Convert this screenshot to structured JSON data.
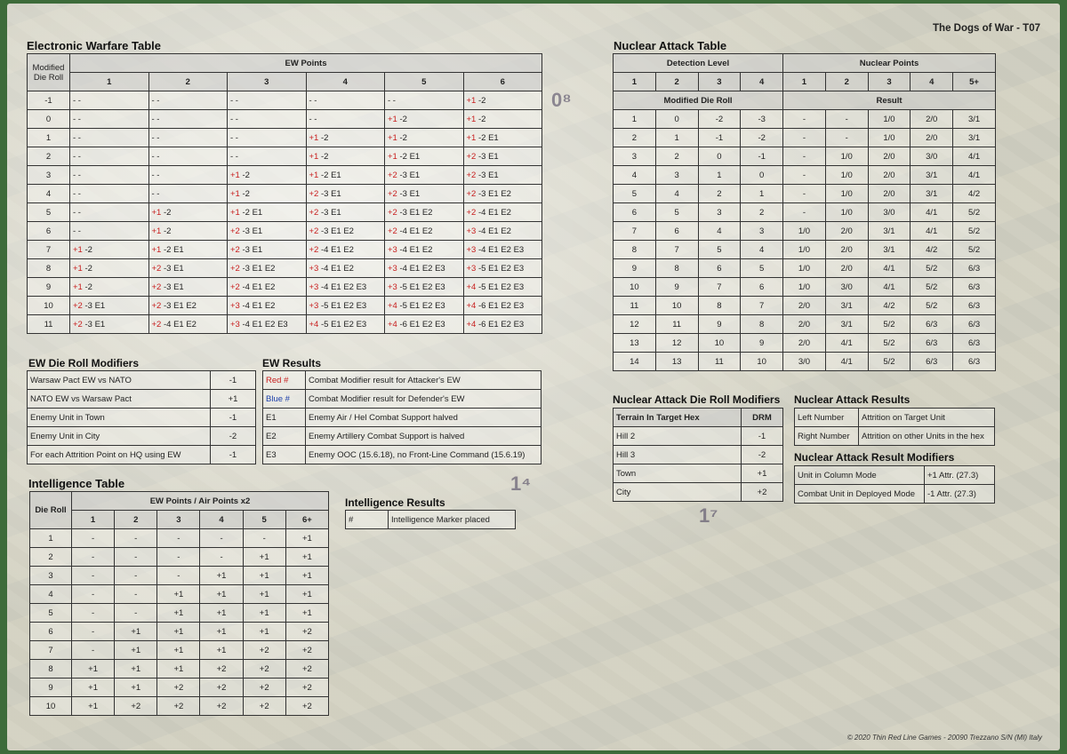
{
  "sheet_title": "The Dogs of War - T07",
  "copyright": "© 2020 Thin Red Line Games - 20090 Trezzano S/N (MI) Italy",
  "map_labels": [
    "0⁸",
    "1⁴",
    "1⁷"
  ],
  "ew_table": {
    "title": "Electronic Warfare Table",
    "corner": "Modified Die Roll",
    "group_header": "EW Points",
    "cols": [
      "1",
      "2",
      "3",
      "4",
      "5",
      "6"
    ],
    "rows": [
      {
        "roll": "-1",
        "cells": [
          [
            "",
            "- -"
          ],
          [
            "",
            "- -"
          ],
          [
            "",
            "- -"
          ],
          [
            "",
            "- -"
          ],
          [
            "",
            "- -"
          ],
          [
            "+1",
            "-2"
          ]
        ]
      },
      {
        "roll": "0",
        "cells": [
          [
            "",
            "- -"
          ],
          [
            "",
            "- -"
          ],
          [
            "",
            "- -"
          ],
          [
            "",
            "- -"
          ],
          [
            "+1",
            "-2"
          ],
          [
            "+1",
            "-2"
          ]
        ]
      },
      {
        "roll": "1",
        "cells": [
          [
            "",
            "- -"
          ],
          [
            "",
            "- -"
          ],
          [
            "",
            "- -"
          ],
          [
            "+1",
            "-2"
          ],
          [
            "+1",
            "-2"
          ],
          [
            "+1",
            "-2  E1"
          ]
        ]
      },
      {
        "roll": "2",
        "cells": [
          [
            "",
            "- -"
          ],
          [
            "",
            "- -"
          ],
          [
            "",
            "- -"
          ],
          [
            "+1",
            "-2"
          ],
          [
            "+1",
            "-2  E1"
          ],
          [
            "+2",
            "-3  E1"
          ]
        ]
      },
      {
        "roll": "3",
        "cells": [
          [
            "",
            "- -"
          ],
          [
            "",
            "- -"
          ],
          [
            "+1",
            "-2"
          ],
          [
            "+1",
            "-2  E1"
          ],
          [
            "+2",
            "-3  E1"
          ],
          [
            "+2",
            "-3  E1"
          ]
        ]
      },
      {
        "roll": "4",
        "cells": [
          [
            "",
            "- -"
          ],
          [
            "",
            "- -"
          ],
          [
            "+1",
            "-2"
          ],
          [
            "+2",
            "-3  E1"
          ],
          [
            "+2",
            "-3  E1"
          ],
          [
            "+2",
            "-3  E1 E2"
          ]
        ]
      },
      {
        "roll": "5",
        "cells": [
          [
            "",
            "- -"
          ],
          [
            "+1",
            "-2"
          ],
          [
            "+1",
            "-2  E1"
          ],
          [
            "+2",
            "-3  E1"
          ],
          [
            "+2",
            "-3  E1 E2"
          ],
          [
            "+2",
            "-4  E1 E2"
          ]
        ]
      },
      {
        "roll": "6",
        "cells": [
          [
            "",
            "- -"
          ],
          [
            "+1",
            "-2"
          ],
          [
            "+2",
            "-3  E1"
          ],
          [
            "+2",
            "-3  E1 E2"
          ],
          [
            "+2",
            "-4  E1 E2"
          ],
          [
            "+3",
            "-4  E1 E2"
          ]
        ]
      },
      {
        "roll": "7",
        "cells": [
          [
            "+1",
            "-2"
          ],
          [
            "+1",
            "-2  E1"
          ],
          [
            "+2",
            "-3  E1"
          ],
          [
            "+2",
            "-4  E1 E2"
          ],
          [
            "+3",
            "-4  E1 E2"
          ],
          [
            "+3",
            "-4  E1 E2 E3"
          ]
        ]
      },
      {
        "roll": "8",
        "cells": [
          [
            "+1",
            "-2"
          ],
          [
            "+2",
            "-3  E1"
          ],
          [
            "+2",
            "-3  E1 E2"
          ],
          [
            "+3",
            "-4  E1 E2"
          ],
          [
            "+3",
            "-4  E1 E2 E3"
          ],
          [
            "+3",
            "-5  E1 E2 E3"
          ]
        ]
      },
      {
        "roll": "9",
        "cells": [
          [
            "+1",
            "-2"
          ],
          [
            "+2",
            "-3  E1"
          ],
          [
            "+2",
            "-4  E1 E2"
          ],
          [
            "+3",
            "-4  E1 E2 E3"
          ],
          [
            "+3",
            "-5  E1 E2 E3"
          ],
          [
            "+4",
            "-5  E1 E2 E3"
          ]
        ]
      },
      {
        "roll": "10",
        "cells": [
          [
            "+2",
            "-3  E1"
          ],
          [
            "+2",
            "-3  E1 E2"
          ],
          [
            "+3",
            "-4  E1 E2"
          ],
          [
            "+3",
            "-5  E1 E2 E3"
          ],
          [
            "+4",
            "-5  E1 E2 E3"
          ],
          [
            "+4",
            "-6  E1 E2 E3"
          ]
        ]
      },
      {
        "roll": "11",
        "cells": [
          [
            "+2",
            "-3  E1"
          ],
          [
            "+2",
            "-4  E1 E2"
          ],
          [
            "+3",
            "-4  E1 E2 E3"
          ],
          [
            "+4",
            "-5  E1 E2 E3"
          ],
          [
            "+4",
            "-6  E1 E2 E3"
          ],
          [
            "+4",
            "-6  E1 E2 E3"
          ]
        ]
      }
    ]
  },
  "ew_modifiers": {
    "title": "EW Die Roll Modifiers",
    "rows": [
      [
        "Warsaw Pact EW vs NATO",
        "-1"
      ],
      [
        "NATO EW vs Warsaw Pact",
        "+1"
      ],
      [
        "Enemy Unit in Town",
        "-1"
      ],
      [
        "Enemy Unit in City",
        "-2"
      ],
      [
        "For each Attrition Point on HQ using EW",
        "-1"
      ]
    ]
  },
  "ew_results": {
    "title": "EW Results",
    "rows": [
      [
        "Red #",
        "Combat Modifier result for Attacker's EW"
      ],
      [
        "Blue #",
        "Combat Modifier result for Defender's EW"
      ],
      [
        "E1",
        "Enemy Air / Hel Combat Support halved"
      ],
      [
        "E2",
        "Enemy Artillery Combat Support is halved"
      ],
      [
        "E3",
        "Enemy OOC (15.6.18), no Front-Line Command (15.6.19)"
      ]
    ]
  },
  "intel_table": {
    "title": "Intelligence Table",
    "corner": "Die Roll",
    "group_header": "EW Points / Air Points x2",
    "cols": [
      "1",
      "2",
      "3",
      "4",
      "5",
      "6+"
    ],
    "rows": [
      [
        "1",
        "-",
        "-",
        "-",
        "-",
        "-",
        "+1"
      ],
      [
        "2",
        "-",
        "-",
        "-",
        "-",
        "+1",
        "+1"
      ],
      [
        "3",
        "-",
        "-",
        "-",
        "+1",
        "+1",
        "+1"
      ],
      [
        "4",
        "-",
        "-",
        "+1",
        "+1",
        "+1",
        "+1"
      ],
      [
        "5",
        "-",
        "-",
        "+1",
        "+1",
        "+1",
        "+1"
      ],
      [
        "6",
        "-",
        "+1",
        "+1",
        "+1",
        "+1",
        "+2"
      ],
      [
        "7",
        "-",
        "+1",
        "+1",
        "+1",
        "+2",
        "+2"
      ],
      [
        "8",
        "+1",
        "+1",
        "+1",
        "+2",
        "+2",
        "+2"
      ],
      [
        "9",
        "+1",
        "+1",
        "+2",
        "+2",
        "+2",
        "+2"
      ],
      [
        "10",
        "+1",
        "+2",
        "+2",
        "+2",
        "+2",
        "+2"
      ]
    ]
  },
  "intel_results": {
    "title": "Intelligence Results",
    "rows": [
      [
        "#",
        "Intelligence Marker placed"
      ]
    ]
  },
  "nuke_table": {
    "title": "Nuclear Attack Table",
    "group_detection": "Detection Level",
    "group_points": "Nuclear Points",
    "detection_cols": [
      "1",
      "2",
      "3",
      "4"
    ],
    "points_cols": [
      "1",
      "2",
      "3",
      "4",
      "5+"
    ],
    "sub_left": "Modified Die Roll",
    "sub_right": "Result",
    "rows": [
      [
        "1",
        "0",
        "-2",
        "-3",
        "-",
        "-",
        "1/0",
        "2/0",
        "3/1"
      ],
      [
        "2",
        "1",
        "-1",
        "-2",
        "-",
        "-",
        "1/0",
        "2/0",
        "3/1"
      ],
      [
        "3",
        "2",
        "0",
        "-1",
        "-",
        "1/0",
        "2/0",
        "3/0",
        "4/1"
      ],
      [
        "4",
        "3",
        "1",
        "0",
        "-",
        "1/0",
        "2/0",
        "3/1",
        "4/1"
      ],
      [
        "5",
        "4",
        "2",
        "1",
        "-",
        "1/0",
        "2/0",
        "3/1",
        "4/2"
      ],
      [
        "6",
        "5",
        "3",
        "2",
        "-",
        "1/0",
        "3/0",
        "4/1",
        "5/2"
      ],
      [
        "7",
        "6",
        "4",
        "3",
        "1/0",
        "2/0",
        "3/1",
        "4/1",
        "5/2"
      ],
      [
        "8",
        "7",
        "5",
        "4",
        "1/0",
        "2/0",
        "3/1",
        "4/2",
        "5/2"
      ],
      [
        "9",
        "8",
        "6",
        "5",
        "1/0",
        "2/0",
        "4/1",
        "5/2",
        "6/3"
      ],
      [
        "10",
        "9",
        "7",
        "6",
        "1/0",
        "3/0",
        "4/1",
        "5/2",
        "6/3"
      ],
      [
        "11",
        "10",
        "8",
        "7",
        "2/0",
        "3/1",
        "4/2",
        "5/2",
        "6/3"
      ],
      [
        "12",
        "11",
        "9",
        "8",
        "2/0",
        "3/1",
        "5/2",
        "6/3",
        "6/3"
      ],
      [
        "13",
        "12",
        "10",
        "9",
        "2/0",
        "4/1",
        "5/2",
        "6/3",
        "6/3"
      ],
      [
        "14",
        "13",
        "11",
        "10",
        "3/0",
        "4/1",
        "5/2",
        "6/3",
        "6/3"
      ]
    ]
  },
  "nuke_modifiers": {
    "title": "Nuclear Attack Die Roll Modifiers",
    "col1": "Terrain In Target Hex",
    "col2": "DRM",
    "rows": [
      [
        "Hill 2",
        "-1"
      ],
      [
        "Hill 3",
        "-2"
      ],
      [
        "Town",
        "+1"
      ],
      [
        "City",
        "+2"
      ]
    ]
  },
  "nuke_results": {
    "title": "Nuclear Attack Results",
    "rows": [
      [
        "Left Number",
        "Attrition on Target Unit"
      ],
      [
        "Right Number",
        "Attrition on other Units in the hex"
      ]
    ]
  },
  "nuke_result_mods": {
    "title": "Nuclear Attack Result Modifiers",
    "rows": [
      [
        "Unit in Column Mode",
        "+1 Attr. (27.3)"
      ],
      [
        "Combat Unit in Deployed Mode",
        "-1 Attr. (27.3)"
      ]
    ]
  }
}
